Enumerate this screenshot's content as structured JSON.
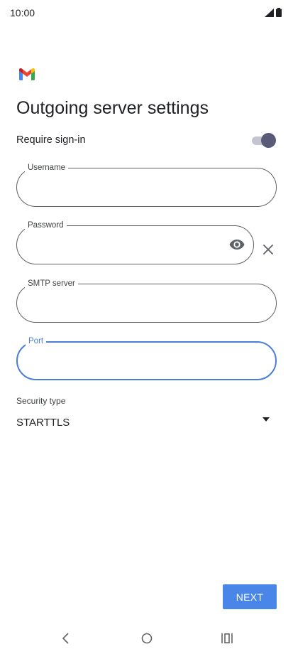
{
  "status_bar": {
    "time": "10:00",
    "icons": [
      "signal-icon",
      "battery-icon"
    ]
  },
  "app": {
    "logo": "gmail-logo",
    "brand_colors": [
      "#ea4335",
      "#4285f4",
      "#34a853",
      "#fbbc04",
      "#c5221f"
    ]
  },
  "page": {
    "title": "Outgoing server settings"
  },
  "require_signin": {
    "label": "Require sign-in",
    "enabled": true
  },
  "fields": {
    "username": {
      "label": "Username",
      "value": ""
    },
    "password": {
      "label": "Password",
      "value": "",
      "icon": "eye-icon",
      "clear_icon": "close-icon"
    },
    "smtp_server": {
      "label": "SMTP server",
      "value": ""
    },
    "port": {
      "label": "Port",
      "value": "",
      "focused": true
    }
  },
  "security": {
    "label": "Security type",
    "selected": "STARTTLS",
    "icon": "dropdown-arrow-icon"
  },
  "actions": {
    "next_label": "NEXT"
  },
  "navigation": {
    "items": [
      "back-icon",
      "home-icon",
      "recents-icon"
    ]
  },
  "colors": {
    "accent": "#4a86e8",
    "focus": "#4a7ed9",
    "toggle_thumb": "#595a78",
    "toggle_track": "#c5c5d2"
  }
}
